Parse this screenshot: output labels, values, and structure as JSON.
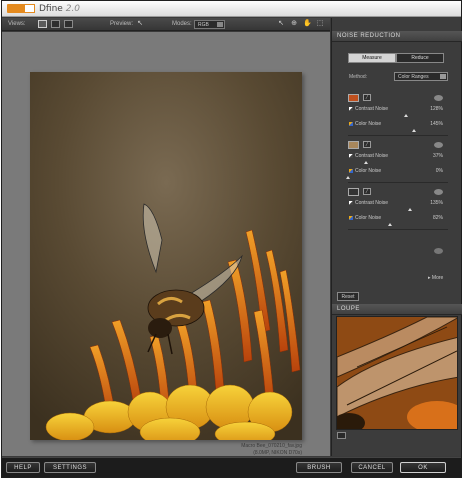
{
  "app": {
    "title": "Dfine",
    "version": "2.0"
  },
  "toolbar": {
    "views_label": "Views:",
    "preview_label": "Preview:",
    "modes_label": "Modes:",
    "mode_value": "RGB"
  },
  "photo": {
    "filename": "Macro Bee_070210_fav.jpg",
    "meta": "(8.0MP, NIKON D70s)"
  },
  "panel": {
    "noise_header": "NOISE REDUCTION",
    "measure_label": "Measure",
    "reduce_label": "Reduce",
    "method_label": "Method:",
    "method_value": "Color Ranges",
    "ranges": [
      {
        "color": "#c0501e",
        "contrast_label": "Contrast Noise",
        "contrast_value": "128%",
        "contrast_level": 0.58,
        "color_label": "Color Noise",
        "color_value": "145%",
        "color_level": 0.66
      },
      {
        "color": "#a8875c",
        "contrast_label": "Contrast Noise",
        "contrast_value": "37%",
        "contrast_level": 0.18,
        "color_label": "Color Noise",
        "color_value": "0%",
        "color_level": 0.0
      },
      {
        "color": "#333333",
        "contrast_label": "Contrast Noise",
        "contrast_value": "135%",
        "contrast_level": 0.62,
        "color_label": "Color Noise",
        "color_value": "82%",
        "color_level": 0.42
      }
    ],
    "more_label": "More",
    "reset_label": "Reset",
    "loupe_header": "LOUPE"
  },
  "bottom": {
    "help_label": "HELP",
    "settings_label": "SETTINGS",
    "brush_label": "BRUSH",
    "cancel_label": "CANCEL",
    "ok_label": "OK"
  },
  "icons": {
    "view_single": "single-view-icon",
    "view_split": "split-view-icon",
    "view_side": "side-by-side-icon",
    "preview_toggle": "preview-cursor-icon",
    "tool_pointer": "pointer-icon",
    "tool_zoom": "zoom-icon",
    "tool_hand": "hand-icon",
    "tool_fit": "fit-icon"
  },
  "colors": {
    "accent": "#e48a1e",
    "panel_bg": "#3c3c3c",
    "canvas_bg": "#7a7a7a"
  }
}
